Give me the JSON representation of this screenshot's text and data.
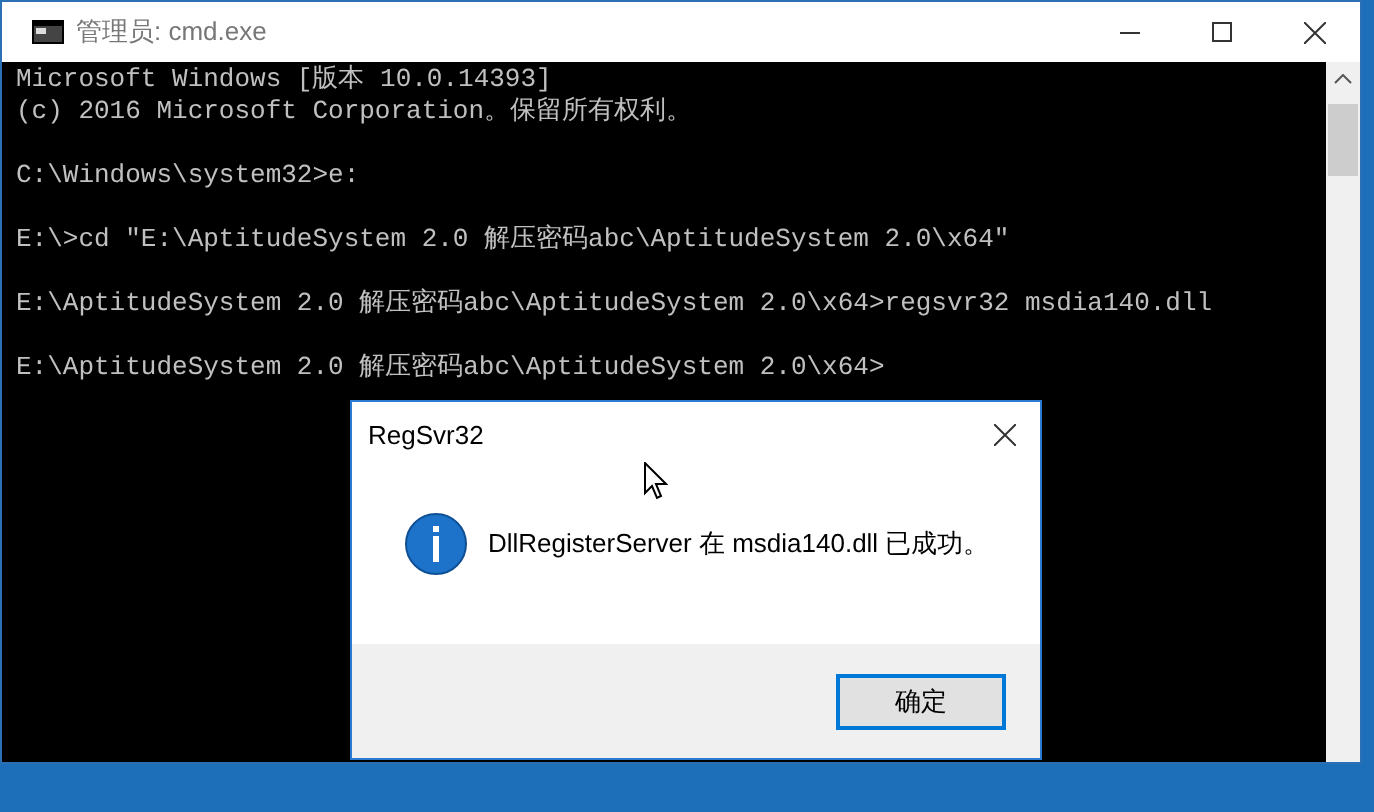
{
  "window": {
    "title": "管理员: cmd.exe"
  },
  "console": {
    "blocks": [
      [
        "Microsoft Windows [版本 10.0.14393]",
        "(c) 2016 Microsoft Corporation。保留所有权利。"
      ],
      [
        "C:\\Windows\\system32>e:"
      ],
      [
        "E:\\>cd \"E:\\AptitudeSystem 2.0 解压密码abc\\AptitudeSystem 2.0\\x64\""
      ],
      [
        "E:\\AptitudeSystem 2.0 解压密码abc\\AptitudeSystem 2.0\\x64>regsvr32 msdia140.dll"
      ],
      [
        "E:\\AptitudeSystem 2.0 解压密码abc\\AptitudeSystem 2.0\\x64>"
      ]
    ]
  },
  "dialog": {
    "title": "RegSvr32",
    "message": "DllRegisterServer 在 msdia140.dll 已成功。",
    "button": "确定"
  }
}
